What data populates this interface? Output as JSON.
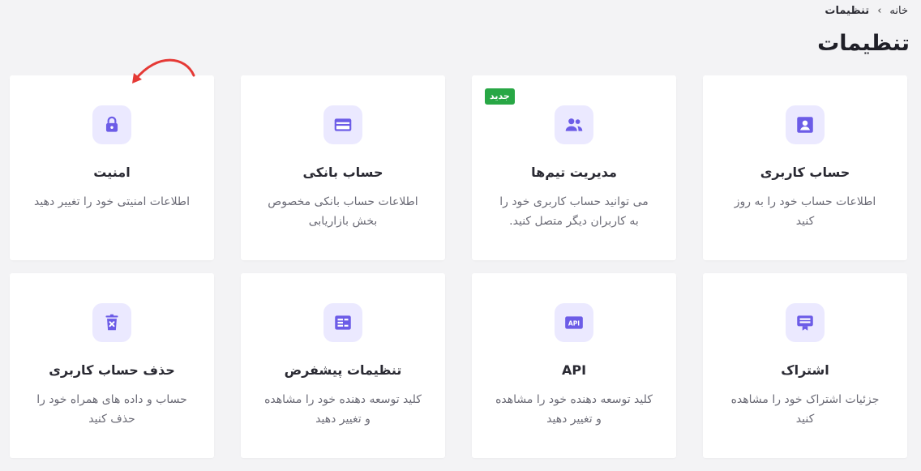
{
  "breadcrumb": {
    "home": "خانه",
    "current": "تنظیمات"
  },
  "page": {
    "title": "تنظیمات"
  },
  "colors": {
    "accent": "#6c5ce7",
    "icon_bg": "#ebe9ff",
    "badge_bg": "#28a745",
    "arrow": "#e53935"
  },
  "cards": [
    {
      "icon": "user-account-icon",
      "title": "حساب کاربری",
      "desc": "اطلاعات حساب خود را به روز کنید"
    },
    {
      "icon": "team-icon",
      "title": "مدیریت تیم‌ها",
      "desc": "می توانید حساب کاربری خود را به کاربران دیگر متصل کنید.",
      "badge": "جدید"
    },
    {
      "icon": "bank-card-icon",
      "title": "حساب بانکی",
      "desc": "اطلاعات حساب بانکی مخصوص بخش بازاریابی"
    },
    {
      "icon": "lock-icon",
      "title": "امنیت",
      "desc": "اطلاعات امنیتی خود را تغییر دهید"
    },
    {
      "icon": "subscription-icon",
      "title": "اشتراک",
      "desc": "جزئیات اشتراک خود را مشاهده کنید"
    },
    {
      "icon": "api-icon",
      "icon_text": "API",
      "title": "API",
      "desc": "کلید توسعه دهنده خود را مشاهده و تغییر دهید"
    },
    {
      "icon": "advanced-settings-icon",
      "title": "تنظیمات پیشفرض",
      "desc": "کلید توسعه دهنده خود را مشاهده و تغییر دهید"
    },
    {
      "icon": "delete-account-icon",
      "title": "حذف حساب کاربری",
      "desc": "حساب و داده های همراه خود را حذف کنید"
    }
  ]
}
